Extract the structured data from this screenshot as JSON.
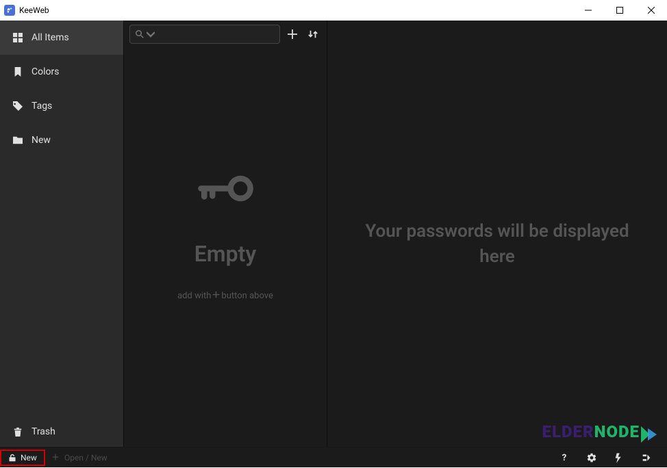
{
  "window": {
    "title": "KeeWeb"
  },
  "sidebar": {
    "all_items": "All Items",
    "colors": "Colors",
    "tags": "Tags",
    "new_folder": "New",
    "trash": "Trash"
  },
  "middle": {
    "empty_title": "Empty",
    "empty_hint_pre": "add with",
    "empty_hint_post": "button above"
  },
  "detail": {
    "placeholder": "Your passwords will be displayed here"
  },
  "footer": {
    "db_name": "New",
    "open_label": "Open / New"
  },
  "logo": {
    "part1": "ELDER",
    "part2": "NODE"
  }
}
